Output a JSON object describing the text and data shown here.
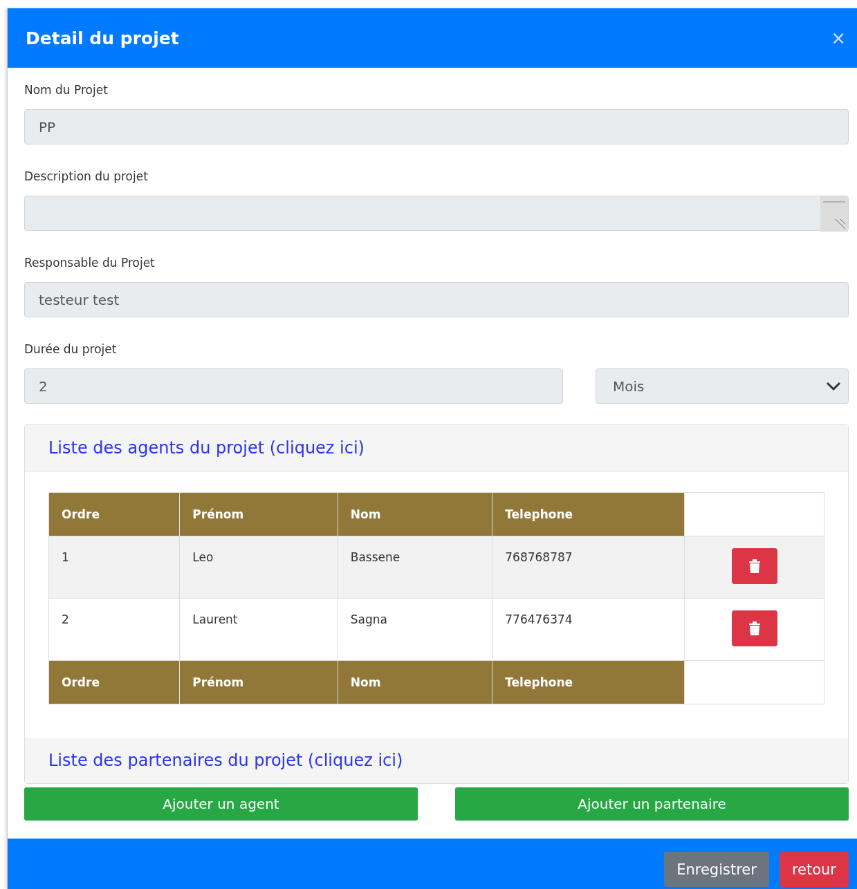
{
  "modal": {
    "title": "Detail du projet",
    "close": "×"
  },
  "fields": [
    {
      "kind": "input",
      "label": "Nom du Projet",
      "value": "PP"
    },
    {
      "kind": "textarea",
      "label": "Description du projet"
    },
    {
      "kind": "input",
      "label": "Responsable du Projet",
      "value": "testeur test"
    }
  ],
  "duration": {
    "label": "Durée du projet",
    "value": "2",
    "unit": "Mois"
  },
  "agents_panel": {
    "title": "Liste des agents du projet (cliquez ici)",
    "columns": [
      "Ordre",
      "Prénom",
      "Nom",
      "Telephone"
    ],
    "rows": [
      {
        "cells": [
          "1",
          "Leo",
          "Bassene",
          "768768787"
        ],
        "striped": true
      },
      {
        "cells": [
          "2",
          "Laurent",
          "Sagna",
          "776476374"
        ],
        "striped": false
      }
    ],
    "footer_columns": [
      "Ordre",
      "Prénom",
      "Nom",
      "Telephone"
    ]
  },
  "partners_panel": {
    "title": "Liste des partenaires du projet (cliquez ici)"
  },
  "actions": [
    "Ajouter un agent",
    "Ajouter un partenaire"
  ],
  "footer_buttons": [
    {
      "label": "Enregistrer",
      "kind": "secondary"
    },
    {
      "label": "retour",
      "kind": "danger"
    }
  ]
}
